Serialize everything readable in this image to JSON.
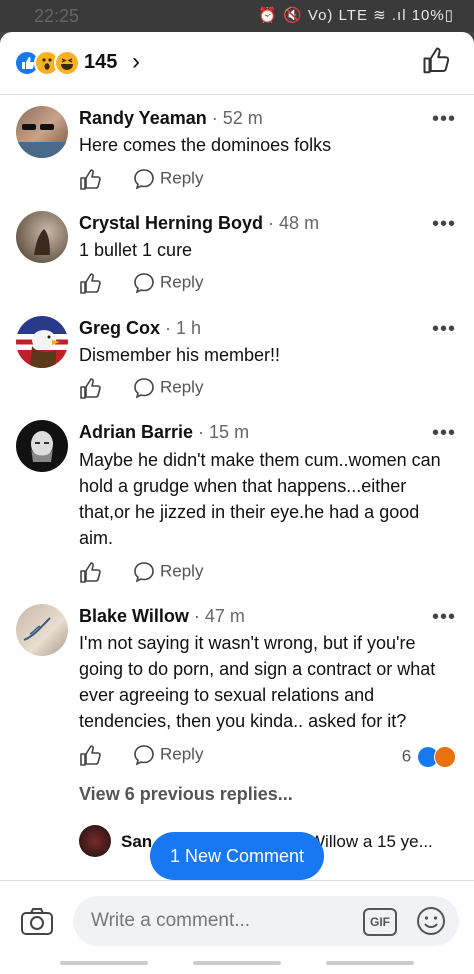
{
  "status_bar": {
    "time": "22:25",
    "right": "⏰ 🔇 Vo) LTE ≋ .ıl 10%▯"
  },
  "reactions_bar": {
    "count": "145",
    "chevron": "›"
  },
  "comments": [
    {
      "name": "Randy Yeaman",
      "time": "52 m",
      "text": "Here comes the dominoes folks",
      "reply_label": "Reply"
    },
    {
      "name": "Crystal Herning Boyd",
      "time": "48 m",
      "text": "1 bullet 1 cure",
      "reply_label": "Reply"
    },
    {
      "name": "Greg Cox",
      "time": "1 h",
      "text": "Dismember his member!!",
      "reply_label": "Reply"
    },
    {
      "name": "Adrian Barrie",
      "time": "15 m",
      "text": "Maybe he didn't make them cum..women can hold a grudge when that happens...either that,or he  jizzed in their eye.he had a good aim.",
      "reply_label": "Reply"
    },
    {
      "name": "Blake Willow",
      "time": "47 m",
      "text": "I'm  not saying it wasn't wrong, but if you're going to do porn, and sign a contract or what ever agreeing to sexual relations and tendencies, then you kinda.. asked for it?",
      "reply_label": "Reply",
      "reaction_count": "6"
    }
  ],
  "more_dots": "•••",
  "view_previous": "View 6 previous replies...",
  "reply_preview": {
    "name_fragment": "San",
    "text_fragment": "Willow a 15 ye..."
  },
  "new_comment_button": "1 New Comment",
  "composer": {
    "placeholder": "Write a comment...",
    "gif_label": "GIF"
  },
  "colors": {
    "accent": "#1877f2",
    "angry": "#e9710f",
    "wow": "#f7b125"
  }
}
